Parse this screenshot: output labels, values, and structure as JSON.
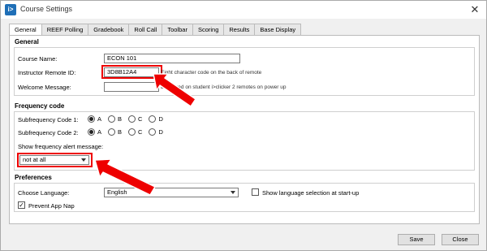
{
  "window": {
    "title": "Course Settings",
    "app_icon_letter": "i>",
    "close_glyph": "✕"
  },
  "tabs": [
    {
      "label": "General",
      "active": true
    },
    {
      "label": "REEF Polling"
    },
    {
      "label": "Gradebook"
    },
    {
      "label": "Roll Call"
    },
    {
      "label": "Toolbar"
    },
    {
      "label": "Scoring"
    },
    {
      "label": "Results"
    },
    {
      "label": "Base Display"
    }
  ],
  "general": {
    "title": "General",
    "course_name_label": "Course Name:",
    "course_name_value": "ECON 101",
    "remote_id_label": "Instructor Remote ID:",
    "remote_id_value": "3D8B12A4",
    "remote_id_hint": "Eight character code on the back of remote",
    "welcome_label": "Welcome Message:",
    "welcome_value": "",
    "welcome_hint": "Displayed on student i>clicker 2 remotes on power up"
  },
  "frequency": {
    "title": "Frequency code",
    "code1_label": "Subfrequency Code 1:",
    "code2_label": "Subfrequency Code 2:",
    "options": [
      "A",
      "B",
      "C",
      "D"
    ],
    "code1_selected": "A",
    "code2_selected": "A",
    "alert_label": "Show frequency alert message:",
    "alert_value": "not at all"
  },
  "preferences": {
    "title": "Preferences",
    "language_label": "Choose Language:",
    "language_value": "English",
    "show_language_label": "Show language selection at start-up",
    "show_language_checked": false,
    "prevent_nap_label": "Prevent App Nap",
    "prevent_nap_checked": true
  },
  "footer": {
    "save_label": "Save",
    "close_label": "Close"
  },
  "colors": {
    "highlight": "#e00000",
    "accent": "#1f6fb7"
  }
}
